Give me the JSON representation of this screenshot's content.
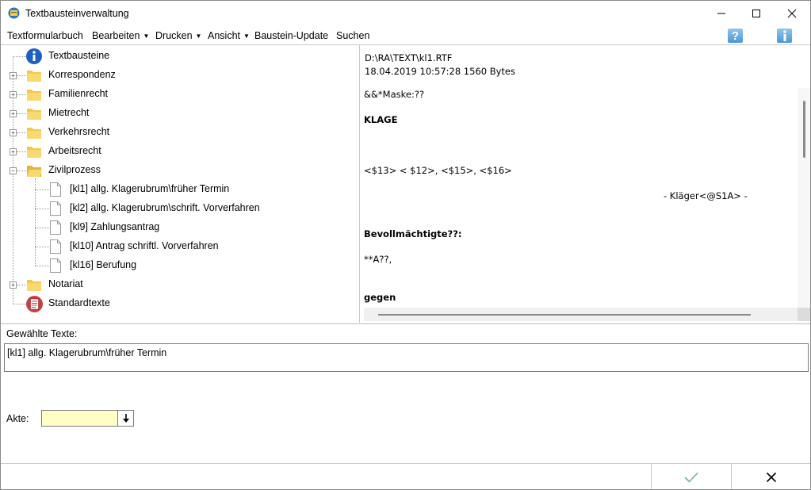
{
  "window": {
    "title": "Textbausteinverwaltung"
  },
  "menu": [
    {
      "label": "Textformularbuch",
      "dropdown": false
    },
    {
      "label": "Bearbeiten",
      "dropdown": true
    },
    {
      "label": "Drucken",
      "dropdown": true
    },
    {
      "label": "Ansicht",
      "dropdown": true
    },
    {
      "label": "Baustein-Update",
      "dropdown": false
    },
    {
      "label": "Suchen",
      "dropdown": false
    }
  ],
  "toolbar_icons": [
    "help-icon",
    "info-icon"
  ],
  "tree": {
    "root": {
      "label": "Textbausteine",
      "icon": "info-icon"
    },
    "folders": [
      {
        "label": "Korrespondenz",
        "expanded": false
      },
      {
        "label": "Familienrecht",
        "expanded": false
      },
      {
        "label": "Mietrecht",
        "expanded": false
      },
      {
        "label": "Verkehrsrecht",
        "expanded": false
      },
      {
        "label": "Arbeitsrecht",
        "expanded": false
      },
      {
        "label": "Zivilprozess",
        "expanded": true
      }
    ],
    "children": [
      {
        "label": "[kl1] allg. Klagerubrum\\früher Termin"
      },
      {
        "label": "[kl2] allg. Klagerubrum\\schrift. Vorverfahren"
      },
      {
        "label": "[kl9] Zahlungsantrag"
      },
      {
        "label": "[kl10] Antrag schriftl. Vorverfahren"
      },
      {
        "label": "[kl16] Berufung"
      }
    ],
    "after": [
      {
        "label": "Notariat",
        "expanded": false
      },
      {
        "label": "Standardtexte",
        "icon": "standard-texts-icon"
      }
    ]
  },
  "preview": {
    "path": "D:\\RA\\TEXT\\kl1.RTF",
    "meta": "18.04.2019 10:57:28  1560 Bytes",
    "lines": [
      {
        "text": "&&*Maske:??",
        "bold": false
      },
      {
        "text": "KLAGE",
        "bold": true
      },
      {
        "text": "<$13> < $12>, <$15>, <$16>",
        "bold": false
      },
      {
        "text": "- Kläger<@S1A> -",
        "bold": false
      },
      {
        "text": "Bevollmächtigte??:",
        "bold": true
      },
      {
        "text": "**A??,",
        "bold": false
      },
      {
        "text": "gegen",
        "bold": true
      }
    ]
  },
  "selected": {
    "label": "Gewählte Texte:",
    "value": "[kl1] allg. Klagerubrum\\früher Termin"
  },
  "akte": {
    "label": "Akte:",
    "value": ""
  },
  "colors": {
    "akte_bg": "#ffffc6",
    "ok_check": "#6fb3a8",
    "folder": "#f3c84a",
    "info_blue": "#1f5fbf"
  }
}
